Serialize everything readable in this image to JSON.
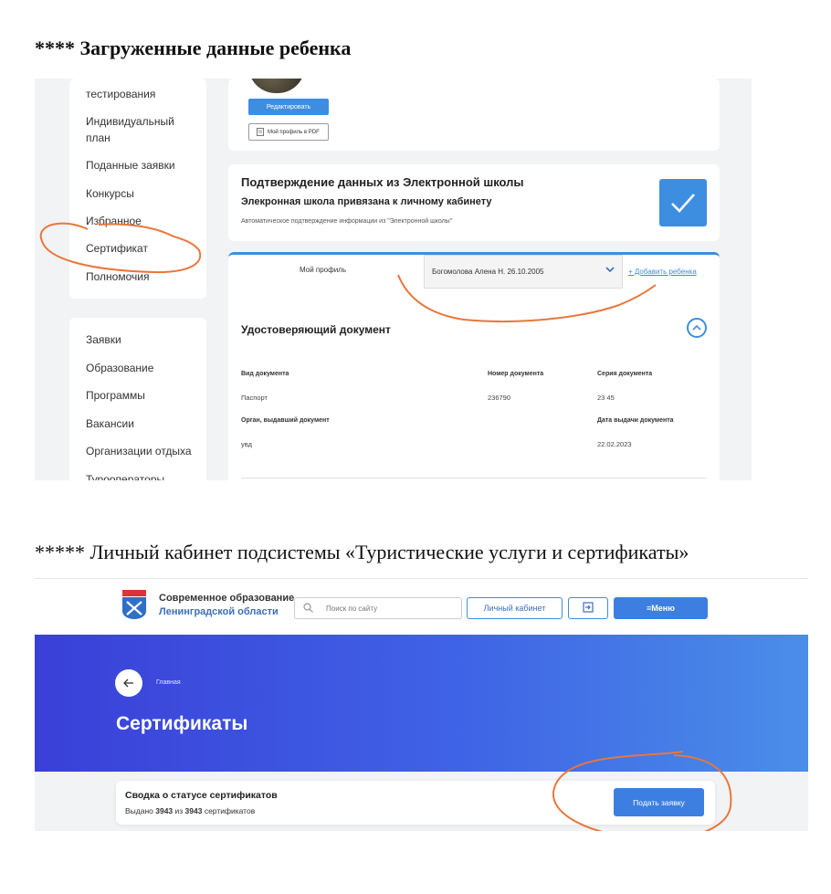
{
  "headings": {
    "first": "**** Загруженные данные ребенка",
    "second": "***** Личный кабинет подсистемы «Туристические услуги и сертификаты»"
  },
  "profile_page": {
    "sidebar_top": [
      "тестирования",
      "Индивидуальный",
      "план",
      "Поданные заявки",
      "Конкурсы",
      "Избранное",
      "Сертификат",
      "Полномочия"
    ],
    "sidebar_bottom": [
      "Заявки",
      "Образование",
      "Программы",
      "Вакансии",
      "Организации отдыха",
      "Турооператоры"
    ],
    "edit_button": "Редактировать",
    "pdf_button": "Мой профиль в PDF",
    "school_card": {
      "title": "Подтверждение данных из Электронной школы",
      "subtitle": "Элекронная школа привязана к личному кабинету",
      "note": "Автоматическое подтверждение информации из \"Электронной школы\""
    },
    "tab_profile": "Мой профиль",
    "child_select": "Богомолова Алена Н. 26.10.2005",
    "add_child": "+ Добавить ребенка",
    "document_section": {
      "title": "Удостоверяющий документ",
      "labels": {
        "doc_type": "Вид документа",
        "doc_number": "Номер документа",
        "doc_series": "Серия документа",
        "issuer": "Орган, выдавший документ",
        "issue_date": "Дата выдачи документа"
      },
      "values": {
        "doc_type": "Паспорт",
        "doc_number": "236790",
        "doc_series": "23 45",
        "issuer": "увд",
        "issue_date": "22.02.2023"
      }
    },
    "colors": {
      "accent": "#3d8ee0",
      "annotation": "#e8773a"
    }
  },
  "cert_page": {
    "brand_line1": "Современное образование",
    "brand_line2": "Ленинградской области",
    "search_placeholder": "Поиск по сайту",
    "cabinet_button": "Личный кабинет",
    "menu_button": "≡Меню",
    "breadcrumb": "Главная",
    "title": "Сертификаты",
    "summary": {
      "title": "Сводка о статусе сертификатов",
      "issued_prefix": "Выдано ",
      "issued": "3943",
      "of": " из ",
      "total": "3943",
      "suffix": " сертификатов"
    },
    "apply_button": "Подать заявку",
    "colors": {
      "hero_start": "#3a3fd8",
      "hero_end": "#4a8ee8",
      "button": "#3d7fe0"
    }
  }
}
